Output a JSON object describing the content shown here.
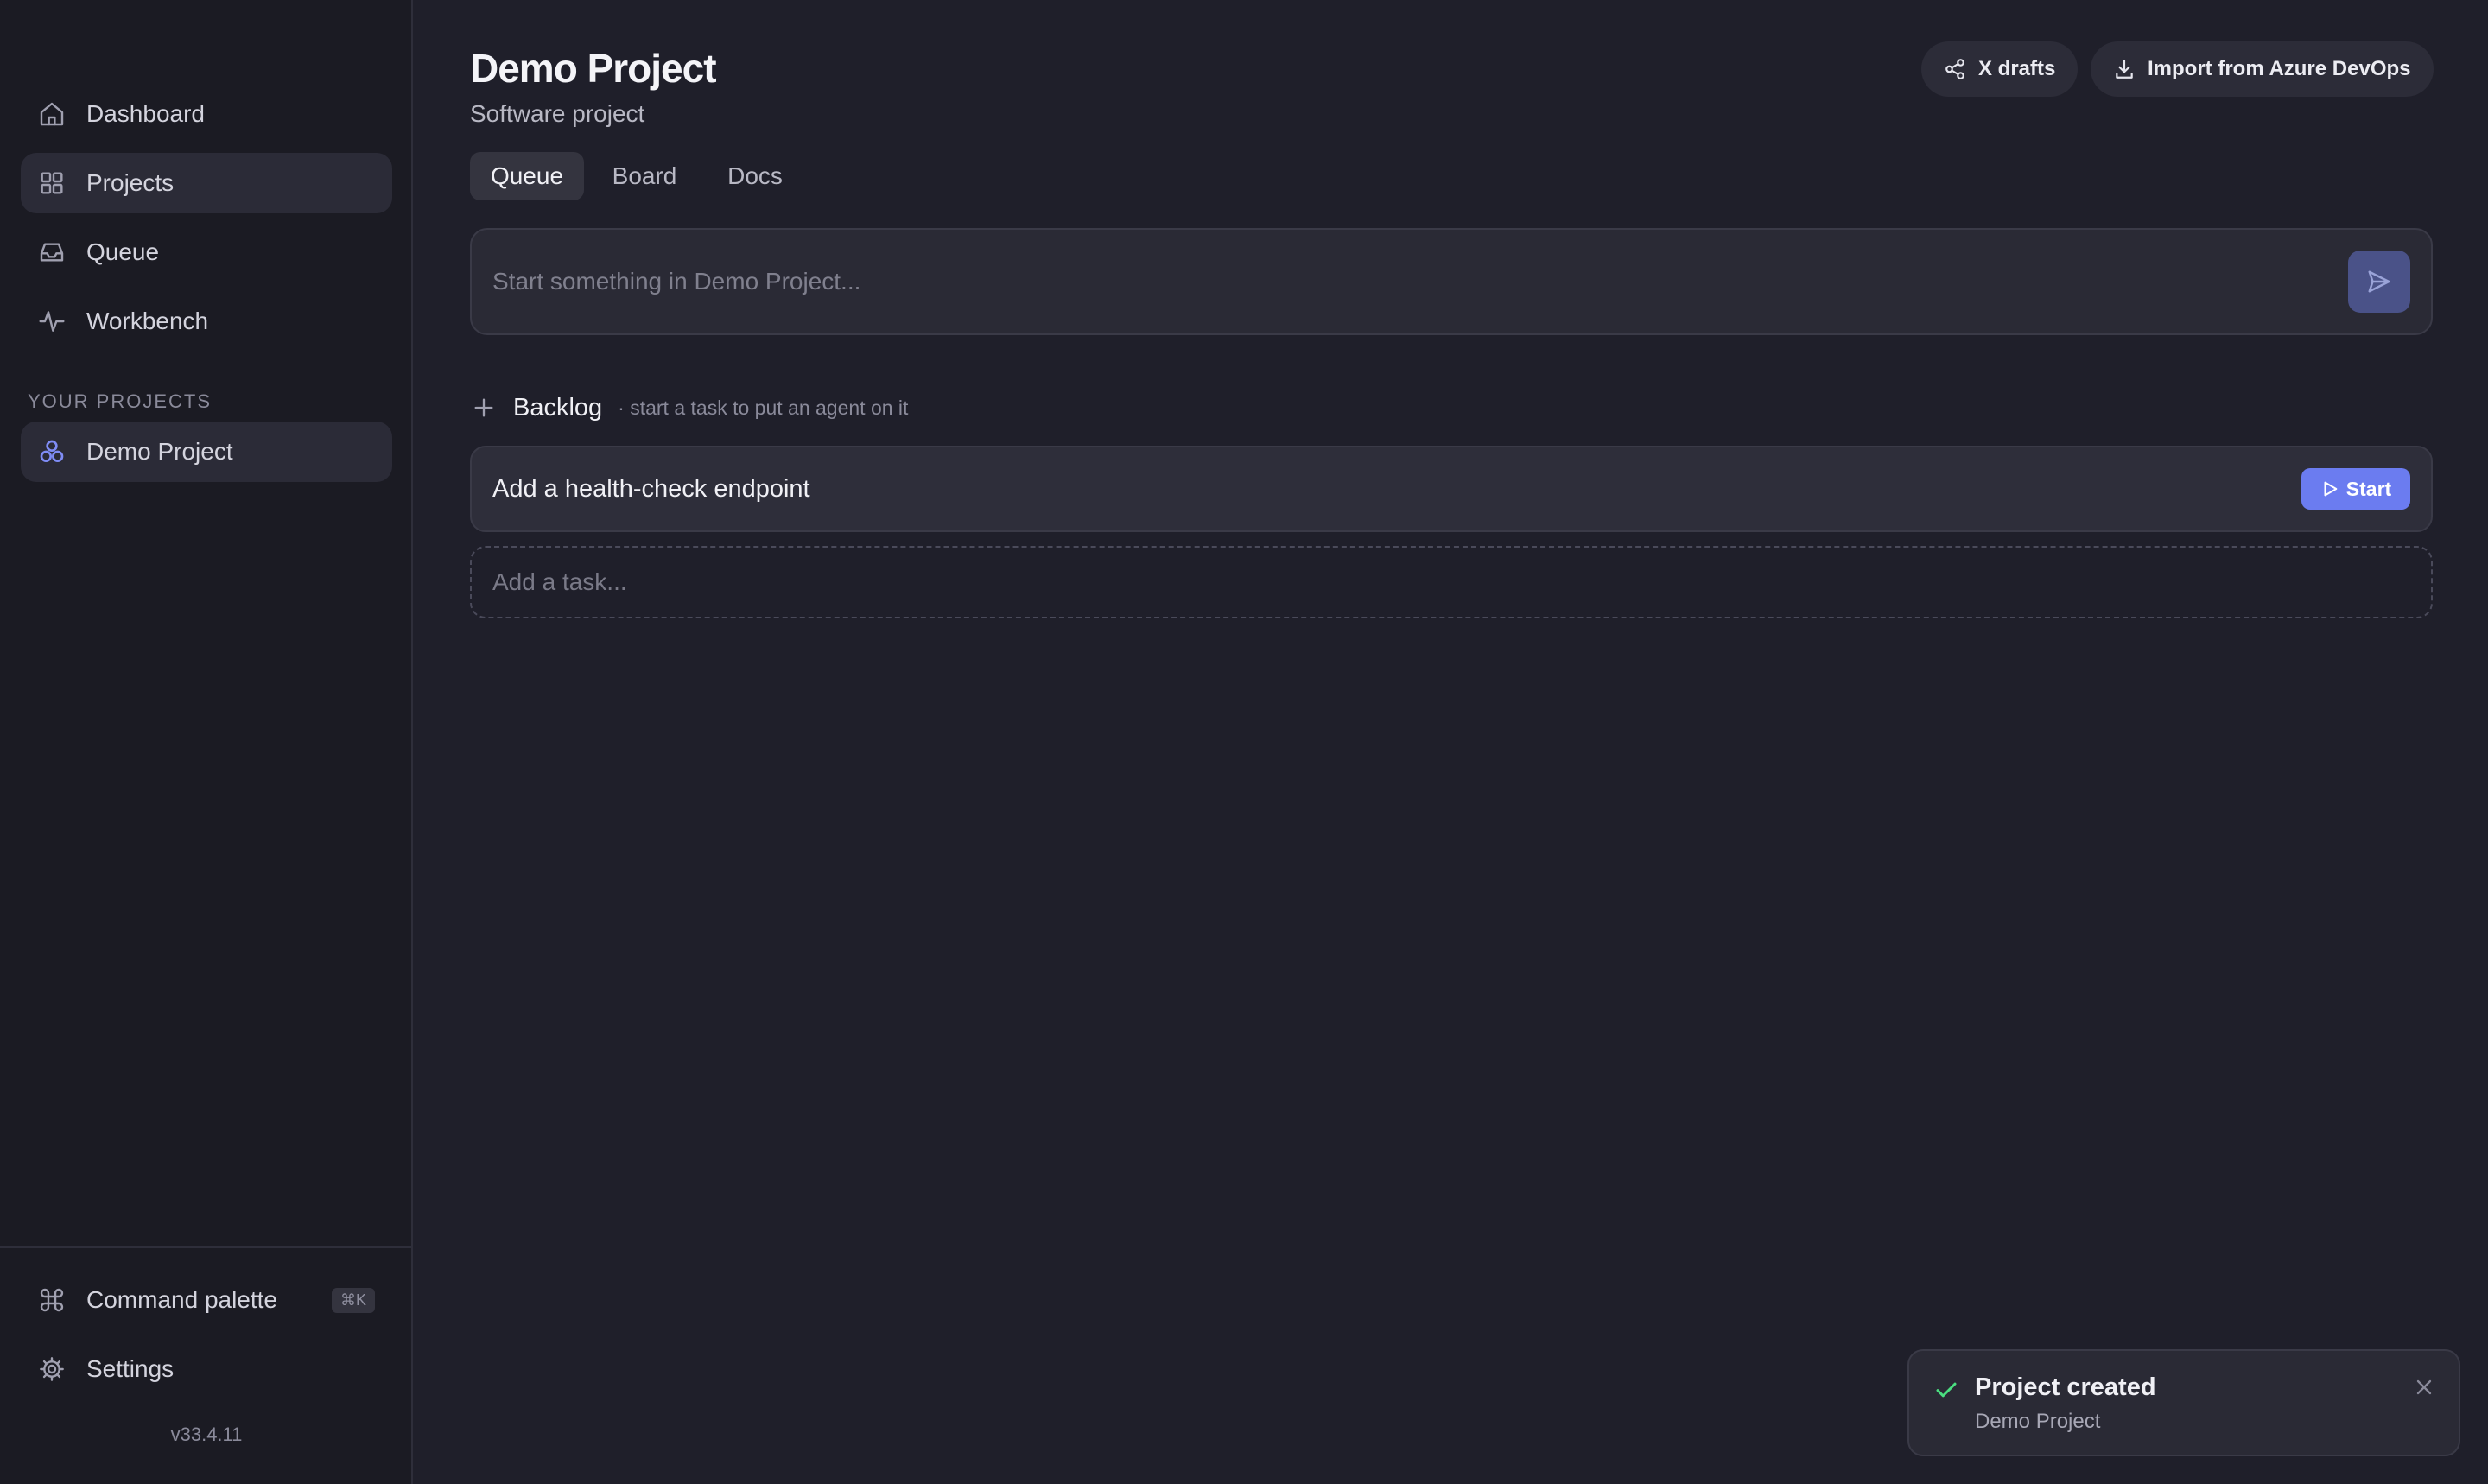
{
  "colors": {
    "accent": "#6b7cf0",
    "success": "#4ade80",
    "background": "#1f1f2a",
    "sidebar": "#1b1b23"
  },
  "sidebar": {
    "nav": [
      {
        "label": "Dashboard",
        "icon": "home-icon"
      },
      {
        "label": "Projects",
        "icon": "grid-icon",
        "active": true
      },
      {
        "label": "Queue",
        "icon": "inbox-icon"
      },
      {
        "label": "Workbench",
        "icon": "activity-icon"
      }
    ],
    "section_label": "YOUR PROJECTS",
    "projects": [
      {
        "label": "Demo Project",
        "icon": "project-icon",
        "active": true
      }
    ],
    "footer": [
      {
        "label": "Command palette",
        "icon": "command-icon",
        "shortcut": "⌘K"
      },
      {
        "label": "Settings",
        "icon": "gear-icon"
      }
    ],
    "version": "v33.4.11"
  },
  "header": {
    "title": "Demo Project",
    "subtitle": "Software project",
    "buttons": {
      "drafts": {
        "label": "X drafts",
        "icon": "share-icon"
      },
      "import": {
        "label": "Import from Azure DevOps",
        "icon": "download-icon"
      }
    }
  },
  "tabs": [
    {
      "label": "Queue",
      "active": true
    },
    {
      "label": "Board"
    },
    {
      "label": "Docs"
    }
  ],
  "prompt": {
    "placeholder": "Start something in Demo Project...",
    "value": ""
  },
  "backlog": {
    "title": "Backlog",
    "hint": "· start a task to put an agent on it",
    "tasks": [
      {
        "title": "Add a health-check endpoint",
        "action": "Start"
      }
    ],
    "add_placeholder": "Add a task..."
  },
  "toast": {
    "title": "Project created",
    "subtitle": "Demo Project"
  }
}
